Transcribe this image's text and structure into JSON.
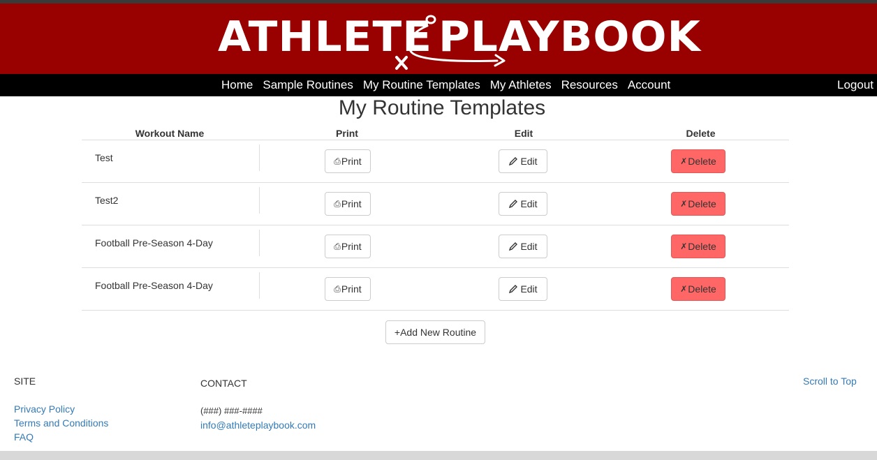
{
  "brand": {
    "word_left": "ATHLETE",
    "word_right": "PLAYBOOK",
    "banner_color": "#990000"
  },
  "nav": {
    "items": [
      "Home",
      "Sample Routines",
      "My Routine Templates",
      "My Athletes",
      "Resources",
      "Account"
    ],
    "logout": "Logout"
  },
  "page": {
    "title": "My Routine Templates"
  },
  "table": {
    "headers": {
      "name": "Workout Name",
      "print": "Print",
      "edit": "Edit",
      "delete": "Delete"
    },
    "rows": [
      {
        "name": "Test"
      },
      {
        "name": "Test2"
      },
      {
        "name": "Football Pre-Season 4-Day"
      },
      {
        "name": "Football Pre-Season 4-Day"
      }
    ],
    "print_label": "Print",
    "edit_label": "Edit",
    "delete_label": "Delete",
    "print_icon": "print-icon",
    "edit_icon": "pencil-icon",
    "delete_icon": "x-icon",
    "delete_color": "#ff6666"
  },
  "add_button": {
    "label": "+Add New Routine"
  },
  "footer": {
    "site_heading": "SITE",
    "site_links": [
      "Privacy Policy",
      "Terms and Conditions",
      "FAQ"
    ],
    "contact_heading": "CONTACT",
    "phone": "(###) ###-####",
    "email": "info@athleteplaybook.com",
    "scroll_top": "Scroll to Top",
    "link_color": "#337ab7"
  }
}
